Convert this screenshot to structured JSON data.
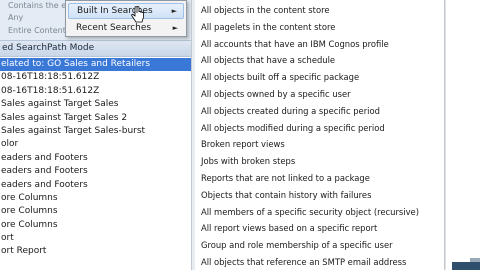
{
  "left_panel": {
    "top_options": [
      "Contains the ex...",
      "Any",
      "Entire Content S..."
    ],
    "mode_label": "ed SearchPath Mode",
    "rows": [
      {
        "text": "elated to: GO Sales and Retailers",
        "selected": true
      },
      {
        "text": "08-16T18:18:51.612Z",
        "selected": false
      },
      {
        "text": "08-16T18:18:51.612Z",
        "selected": false
      },
      {
        "text": "Sales against Target Sales",
        "selected": false
      },
      {
        "text": "Sales against Target Sales 2",
        "selected": false
      },
      {
        "text": "Sales against Target Sales-burst",
        "selected": false
      },
      {
        "text": "olor",
        "selected": false
      },
      {
        "text": "eaders and Footers",
        "selected": false
      },
      {
        "text": "eaders and Footers",
        "selected": false
      },
      {
        "text": "eaders and Footers",
        "selected": false
      },
      {
        "text": "ore Columns",
        "selected": false
      },
      {
        "text": "ore Columns",
        "selected": false
      },
      {
        "text": "ore Columns",
        "selected": false
      },
      {
        "text": "ort",
        "selected": false
      },
      {
        "text": "ort Report",
        "selected": false
      }
    ]
  },
  "context_menu": {
    "items": [
      {
        "label": "Built In Searches",
        "has_submenu": true,
        "hovered": true
      },
      {
        "label": "Recent Searches",
        "has_submenu": true,
        "hovered": false
      }
    ]
  },
  "submenu": {
    "items": [
      "All objects in the content store",
      "All pagelets in the content store",
      "All accounts that have an IBM Cognos profile",
      "All objects that have a schedule",
      "All objects built off a specific package",
      "All objects owned by a specific user",
      "All objects created during a specific period",
      "All objects modified during a specific period",
      "Broken report views",
      "Jobs with broken steps",
      "Reports that are not linked to a package",
      "Objects that contain history with failures",
      "All members of a specific security object (recursive)",
      "All report views based on a specific report",
      "Group and role membership of a specific user",
      "All objects that reference an SMTP email address"
    ]
  },
  "colors": {
    "selection": "#3a78d8",
    "mode_bar": "#c9d6e6",
    "menu_hover": "#cfe1f6"
  }
}
